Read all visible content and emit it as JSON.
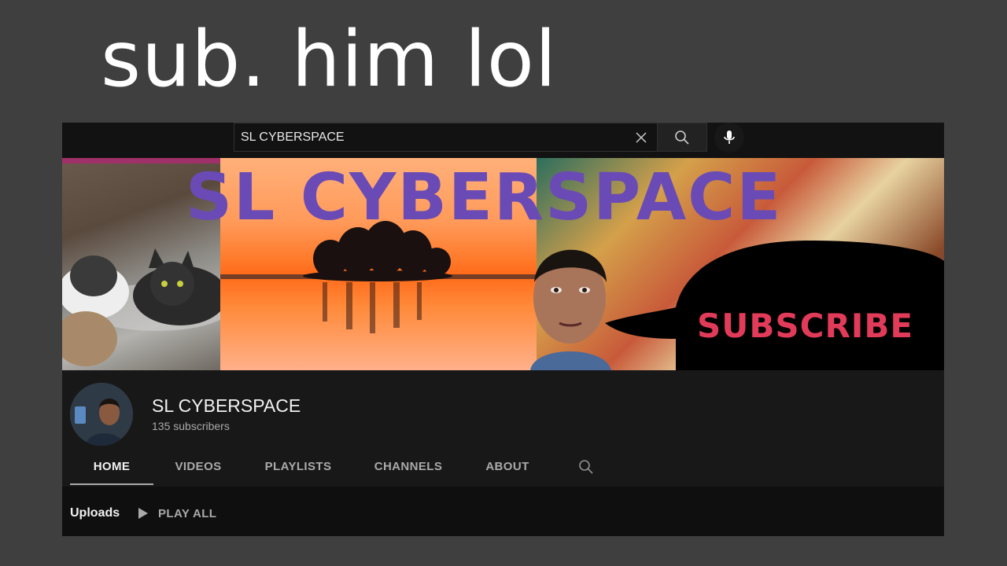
{
  "caption": "sub. him lol",
  "search": {
    "value": "SL CYBERSPACE",
    "clear_icon": "close-icon",
    "search_icon": "search-icon",
    "mic_icon": "mic-icon"
  },
  "banner": {
    "title": "SL CYBERSPACE",
    "subscribe_text": "SUBSCRIBE"
  },
  "channel": {
    "name": "SL CYBERSPACE",
    "subscribers": "135 subscribers"
  },
  "tabs": [
    {
      "label": "HOME",
      "active": true
    },
    {
      "label": "VIDEOS"
    },
    {
      "label": "PLAYLISTS"
    },
    {
      "label": "CHANNELS"
    },
    {
      "label": "ABOUT"
    }
  ],
  "uploads": {
    "title": "Uploads",
    "play_all": "PLAY ALL"
  },
  "colors": {
    "page_bg": "#3f3f3f",
    "app_bg": "#0f0f0f",
    "header_bg": "#181818",
    "banner_title": "#6a4bb5",
    "banner_subscribe": "#e23b5a"
  }
}
